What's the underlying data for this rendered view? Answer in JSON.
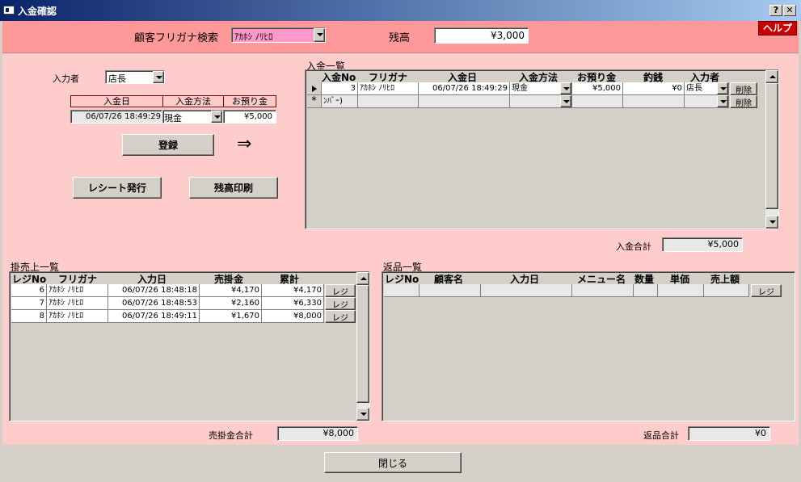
{
  "window": {
    "title": "入金確認",
    "help_btn": "?",
    "close_btn": "✕"
  },
  "header": {
    "search_label": "顧客フリガナ検索",
    "search_value": "ｱｶﾎｼ ﾉﾘﾋﾛ",
    "balance_label": "残高",
    "balance_value": "¥3,000",
    "help_label": "ヘルプ",
    "color": "#ff9999"
  },
  "entry": {
    "operator_label": "入力者",
    "operator_value": "店長",
    "cols": [
      "入金日",
      "入金方法",
      "お預り金"
    ],
    "date": "06/07/26 18:49:29",
    "method": "現金",
    "amount": "¥5,000",
    "register_btn": "登録",
    "arrow": "⇒",
    "receipt_btn": "レシート発行",
    "balance_print_btn": "残高印刷"
  },
  "payments": {
    "title": "入金一覧",
    "cols": [
      "入金No",
      "フリガナ",
      "入金日",
      "入金方法",
      "お預り金",
      "釣銭",
      "入力者"
    ],
    "row1": {
      "no": "3",
      "kana": "ｱｶﾎｼ ﾉﾘﾋﾛ",
      "date": "06/07/26 18:49:29",
      "method": "現金",
      "deposit": "¥5,000",
      "change": "¥0",
      "operator": "店長",
      "delete": "削除"
    },
    "row2": {
      "no": "ﾝﾊﾞｰ)",
      "delete": "削除"
    },
    "total_label": "入金合計",
    "total_value": "¥5,000"
  },
  "credit_sales": {
    "title": "掛売上一覧",
    "cols": [
      "レジNo",
      "フリガナ",
      "入力日",
      "売掛金",
      "累計"
    ],
    "rows": [
      {
        "no": "6",
        "kana": "ｱｶﾎｼ ﾉﾘﾋﾛ",
        "date": "06/07/26 18:48:18",
        "amount": "¥4,170",
        "total": "¥4,170",
        "btn": "レジ"
      },
      {
        "no": "7",
        "kana": "ｱｶﾎｼ ﾉﾘﾋﾛ",
        "date": "06/07/26 18:48:53",
        "amount": "¥2,160",
        "total": "¥6,330",
        "btn": "レジ"
      },
      {
        "no": "8",
        "kana": "ｱｶﾎｼ ﾉﾘﾋﾛ",
        "date": "06/07/26 18:49:11",
        "amount": "¥1,670",
        "total": "¥8,000",
        "btn": "レジ"
      }
    ],
    "total_label": "売掛金合計",
    "total_value": "¥8,000"
  },
  "returns": {
    "title": "返品一覧",
    "cols": [
      "レジNo",
      "顧客名",
      "入力日",
      "メニュー名",
      "数量",
      "単価",
      "売上額"
    ],
    "row_btn": "レジ",
    "total_label": "返品合計",
    "total_value": "¥0"
  },
  "footer": {
    "close_btn": "閉じる"
  }
}
